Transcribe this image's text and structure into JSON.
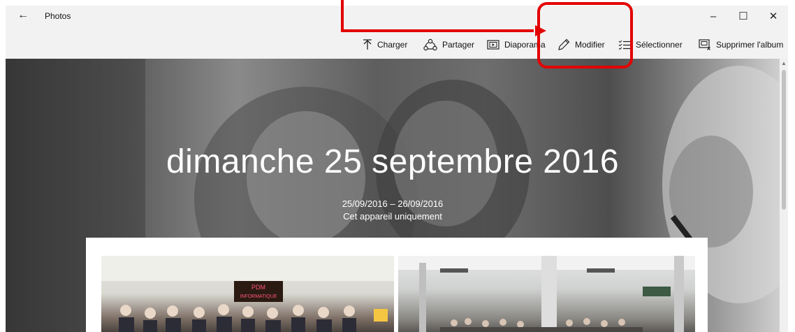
{
  "app": {
    "title": "Photos"
  },
  "toolbar": {
    "upload_label": "Charger",
    "share_label": "Partager",
    "slideshow_label": "Diaporama",
    "edit_label": "Modifier",
    "select_label": "Sélectionner",
    "delete_album_label": "Supprimer l'album"
  },
  "album": {
    "title": "dimanche 25 septembre 2016",
    "date_range": "25/09/2016 – 26/09/2016",
    "location": "Cet appareil uniquement"
  },
  "photos": {
    "sign_line1": "PDM",
    "sign_line2": "INFORMATIQUE"
  },
  "annotation": {
    "color": "#e30000",
    "target": "Modifier"
  },
  "colors": {
    "titlebar": "#f2f2f2",
    "accent": "#e30000"
  }
}
